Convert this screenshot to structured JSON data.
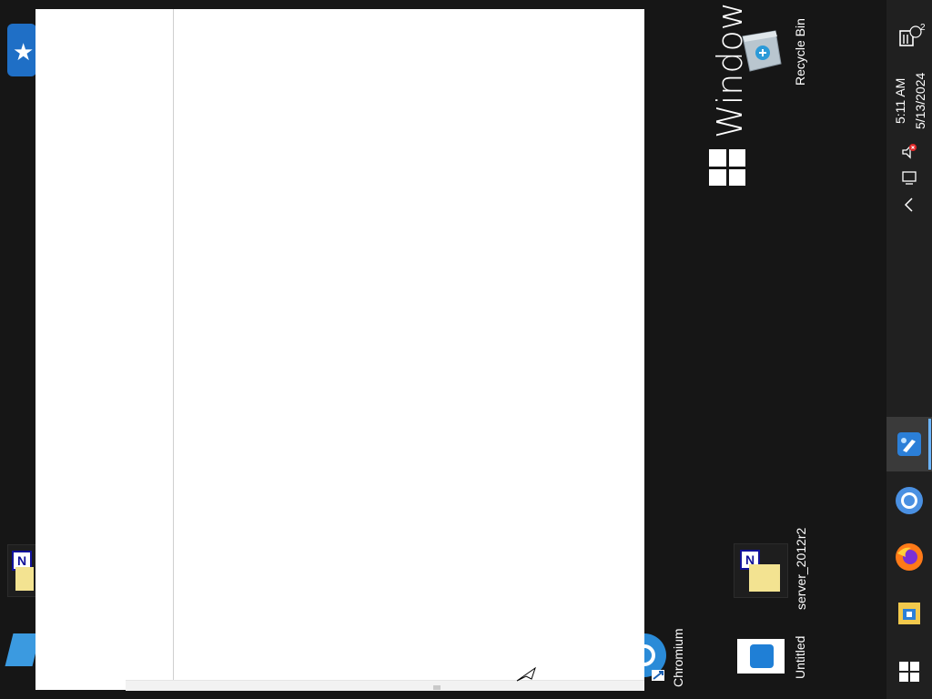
{
  "desktop": {
    "branding_text": "Windows S",
    "icons": [
      {
        "label": "Recycle Bin",
        "icon": "recycle-bin-icon"
      },
      {
        "label": "server_2012r2",
        "icon": "document-folder-icon"
      },
      {
        "label": "Untitled",
        "icon": "image-file-icon"
      },
      {
        "label": "Chromium",
        "icon": "chromium-shortcut-icon"
      }
    ]
  },
  "window": {
    "state": "blank content area"
  },
  "taskbar": {
    "time": "5:11 AM",
    "date": "5/13/2024",
    "notification_count": "2",
    "tray_icons": [
      "notifications-icon",
      "volume-muted-icon",
      "network-icon",
      "show-hidden-icons-chevron"
    ],
    "apps": [
      "paint-app-icon",
      "chromium-app-icon",
      "firefox-app-icon",
      "file-explorer-icon",
      "start-windows-icon"
    ],
    "accent_color": "#6bb5ff"
  }
}
